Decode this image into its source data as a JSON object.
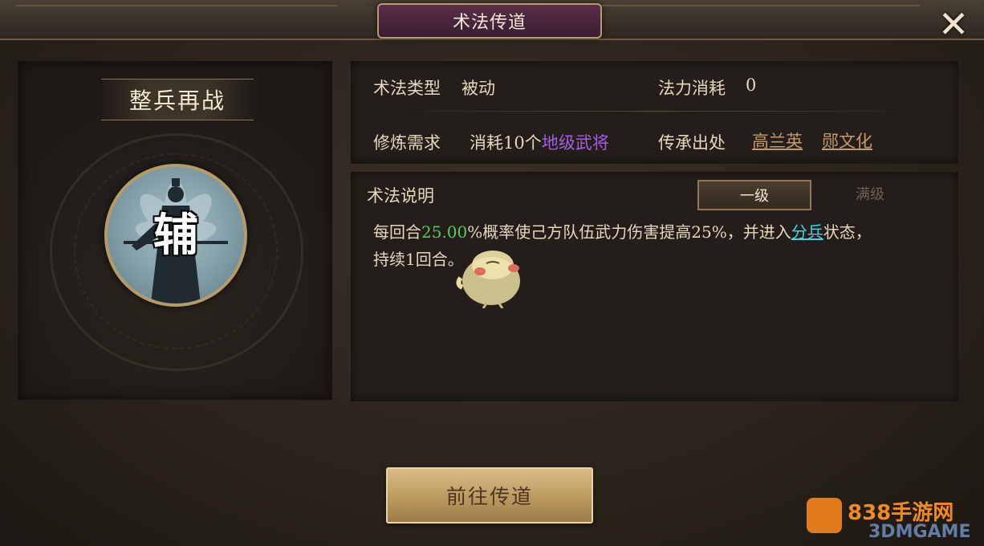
{
  "header": {
    "title": "术法传道",
    "close_icon": "close-x-icon"
  },
  "skill": {
    "name": "整兵再战",
    "portrait_char": "辅"
  },
  "info": {
    "type_label": "术法类型",
    "type_value": "被动",
    "mana_label": "法力消耗",
    "mana_value": "0",
    "train_label": "修炼需求",
    "train_prefix": "消耗10个",
    "train_highlight": "地级武将",
    "inherit_label": "传承出处",
    "inherit_sources": [
      "高兰英",
      "郧文化"
    ]
  },
  "description": {
    "title": "术法说明",
    "tabs": [
      {
        "label": "一级",
        "active": true
      },
      {
        "label": "满级",
        "active": false
      }
    ],
    "text_1": "每回合",
    "text_rate": "25.00",
    "text_2": "%概率使己方队伍武力伤害提高25%，并进入",
    "text_status": "分兵",
    "text_3": "状态，",
    "text_4": "持续1回合。"
  },
  "actions": {
    "go_label": "前往传道"
  },
  "watermark": {
    "site": "838手游网",
    "brand": "3DMGAME"
  },
  "colors": {
    "title_plate": "#5a2f4a",
    "rate_green": "#5ec85b",
    "status_cyan": "#3fd7e6",
    "highlight_purple": "#a35ee6",
    "button_gold": "#c9a86c"
  }
}
